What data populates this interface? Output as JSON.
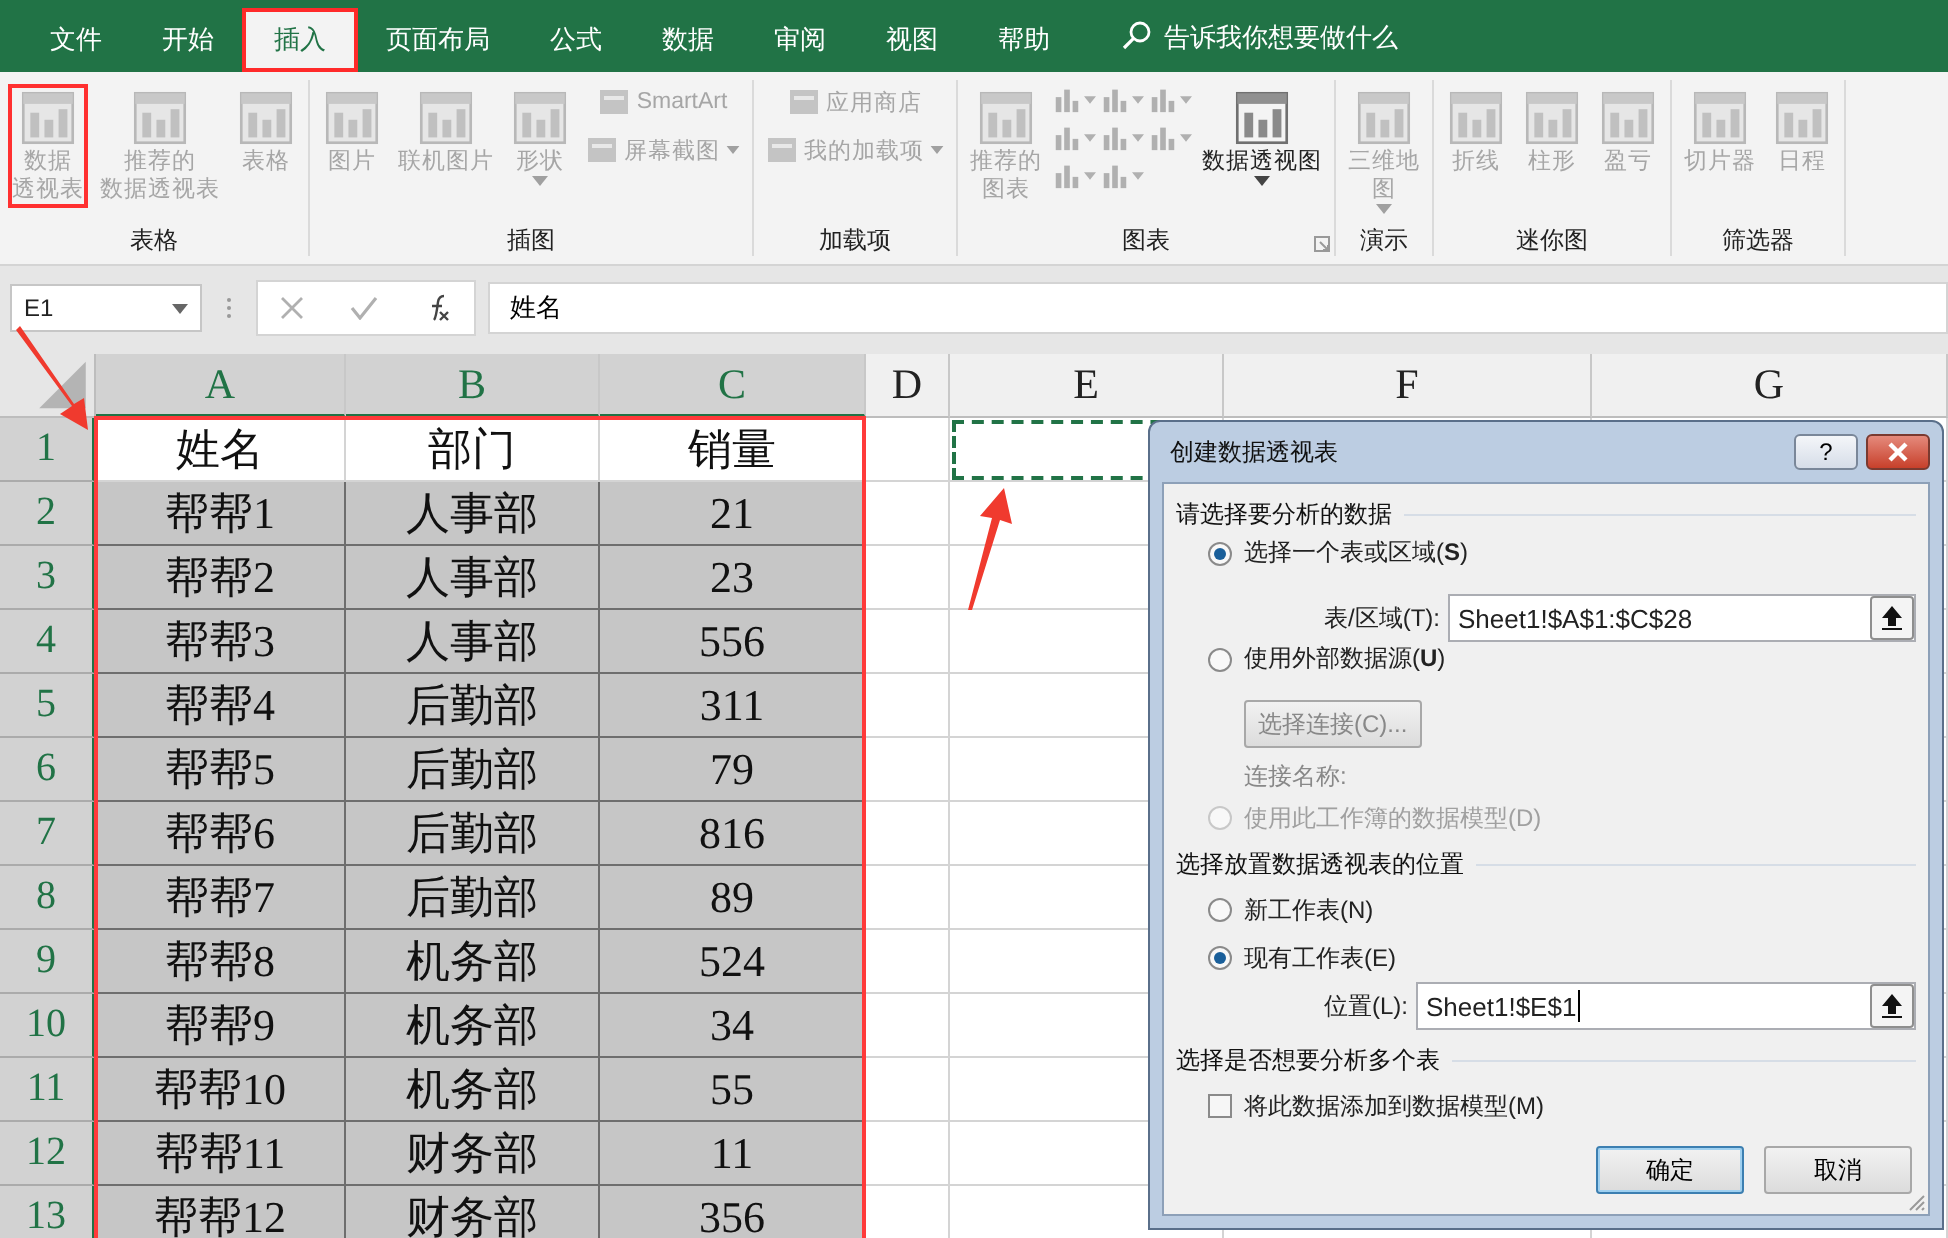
{
  "ribbon_tabs": [
    {
      "label": "文件",
      "selected": false,
      "highlighted": false
    },
    {
      "label": "开始",
      "selected": false,
      "highlighted": false
    },
    {
      "label": "插入",
      "selected": true,
      "highlighted": true
    },
    {
      "label": "页面布局",
      "selected": false,
      "highlighted": false
    },
    {
      "label": "公式",
      "selected": false,
      "highlighted": false
    },
    {
      "label": "数据",
      "selected": false,
      "highlighted": false
    },
    {
      "label": "审阅",
      "selected": false,
      "highlighted": false
    },
    {
      "label": "视图",
      "selected": false,
      "highlighted": false
    },
    {
      "label": "帮助",
      "selected": false,
      "highlighted": false
    }
  ],
  "tell_me": {
    "placeholder": "告诉我你想要做什么"
  },
  "ribbon_groups": [
    {
      "label": "表格",
      "columns": [
        [
          {
            "kind": "large",
            "lines": [
              "数据",
              "透视表"
            ],
            "disabled": true,
            "highlighted": true
          }
        ],
        [
          {
            "kind": "large",
            "lines": [
              "推荐的",
              "数据透视表"
            ],
            "disabled": true
          }
        ],
        [
          {
            "kind": "large",
            "lines": [
              "表格"
            ],
            "disabled": true
          }
        ]
      ]
    },
    {
      "label": "插图",
      "columns": [
        [
          {
            "kind": "large",
            "lines": [
              "图片"
            ],
            "disabled": true
          }
        ],
        [
          {
            "kind": "large",
            "lines": [
              "联机图片"
            ],
            "disabled": true
          }
        ],
        [
          {
            "kind": "large",
            "lines": [
              "形状"
            ],
            "disabled": true,
            "dropdown": true
          }
        ],
        [
          {
            "kind": "small",
            "lines": [
              "SmartArt"
            ],
            "disabled": true
          },
          {
            "kind": "small",
            "lines": [
              "屏幕截图"
            ],
            "disabled": true,
            "dropdown": true
          }
        ]
      ]
    },
    {
      "label": "加载项",
      "columns": [
        [
          {
            "kind": "small",
            "lines": [
              "应用商店"
            ],
            "disabled": true
          },
          {
            "kind": "small",
            "lines": [
              "我的加载项"
            ],
            "disabled": true,
            "dropdown": true
          }
        ]
      ]
    },
    {
      "label": "图表",
      "launcher": true,
      "columns": [
        [
          {
            "kind": "large",
            "lines": [
              "推荐的",
              "图表"
            ],
            "disabled": true
          }
        ],
        [
          {
            "kind": "chart-menu",
            "disabled": true
          },
          {
            "kind": "chart-menu",
            "disabled": true
          },
          {
            "kind": "chart-menu",
            "disabled": true
          }
        ],
        [
          {
            "kind": "chart-menu",
            "disabled": true
          },
          {
            "kind": "chart-menu",
            "disabled": true
          },
          {
            "kind": "chart-menu",
            "disabled": true
          }
        ],
        [
          {
            "kind": "chart-menu",
            "disabled": true
          },
          {
            "kind": "chart-menu",
            "disabled": true
          }
        ],
        [
          {
            "kind": "large",
            "lines": [
              "数据透视图"
            ],
            "disabled": false,
            "dropdown": true
          }
        ]
      ]
    },
    {
      "label": "演示",
      "columns": [
        [
          {
            "kind": "large",
            "lines": [
              "三维地",
              "图"
            ],
            "disabled": true,
            "dropdown": true
          }
        ]
      ]
    },
    {
      "label": "迷你图",
      "columns": [
        [
          {
            "kind": "large",
            "lines": [
              "折线"
            ],
            "disabled": true
          }
        ],
        [
          {
            "kind": "large",
            "lines": [
              "柱形"
            ],
            "disabled": true
          }
        ],
        [
          {
            "kind": "large",
            "lines": [
              "盈亏"
            ],
            "disabled": true
          }
        ]
      ]
    },
    {
      "label": "筛选器",
      "columns": [
        [
          {
            "kind": "large",
            "lines": [
              "切片器"
            ],
            "disabled": true
          }
        ],
        [
          {
            "kind": "large",
            "lines": [
              "日程"
            ],
            "disabled": true
          }
        ]
      ]
    }
  ],
  "formula_bar": {
    "name_box": "E1",
    "value": "姓名"
  },
  "sheet": {
    "columns": [
      {
        "label": "A",
        "selected": true
      },
      {
        "label": "B",
        "selected": true
      },
      {
        "label": "C",
        "selected": true
      },
      {
        "label": "D",
        "selected": false
      },
      {
        "label": "E",
        "selected": false
      },
      {
        "label": "F",
        "selected": false
      },
      {
        "label": "G",
        "selected": false
      }
    ],
    "rows": [
      {
        "number": "1",
        "shaded": false,
        "marquee_e": true,
        "cells": [
          "姓名",
          "部门",
          "销量"
        ]
      },
      {
        "number": "2",
        "shaded": true,
        "marquee_e": false,
        "cells": [
          "帮帮1",
          "人事部",
          "21"
        ]
      },
      {
        "number": "3",
        "shaded": true,
        "marquee_e": false,
        "cells": [
          "帮帮2",
          "人事部",
          "23"
        ]
      },
      {
        "number": "4",
        "shaded": true,
        "marquee_e": false,
        "cells": [
          "帮帮3",
          "人事部",
          "556"
        ]
      },
      {
        "number": "5",
        "shaded": true,
        "marquee_e": false,
        "cells": [
          "帮帮4",
          "后勤部",
          "311"
        ]
      },
      {
        "number": "6",
        "shaded": true,
        "marquee_e": false,
        "cells": [
          "帮帮5",
          "后勤部",
          "79"
        ]
      },
      {
        "number": "7",
        "shaded": true,
        "marquee_e": false,
        "cells": [
          "帮帮6",
          "后勤部",
          "816"
        ]
      },
      {
        "number": "8",
        "shaded": true,
        "marquee_e": false,
        "cells": [
          "帮帮7",
          "后勤部",
          "89"
        ]
      },
      {
        "number": "9",
        "shaded": true,
        "marquee_e": false,
        "cells": [
          "帮帮8",
          "机务部",
          "524"
        ]
      },
      {
        "number": "10",
        "shaded": true,
        "marquee_e": false,
        "cells": [
          "帮帮9",
          "机务部",
          "34"
        ]
      },
      {
        "number": "11",
        "shaded": true,
        "marquee_e": false,
        "cells": [
          "帮帮10",
          "机务部",
          "55"
        ]
      },
      {
        "number": "12",
        "shaded": true,
        "marquee_e": false,
        "cells": [
          "帮帮11",
          "财务部",
          "11"
        ]
      },
      {
        "number": "13",
        "shaded": true,
        "marquee_e": false,
        "cells": [
          "帮帮12",
          "财务部",
          "356"
        ]
      }
    ]
  },
  "dialog": {
    "title": "创建数据透视表",
    "help": "?",
    "section_1": "请选择要分析的数据",
    "source_options": [
      {
        "label": "选择一个表或区域(**S**)",
        "selected": true,
        "disabled": false
      },
      {
        "label": "使用外部数据源(**U**)",
        "selected": false,
        "disabled": false
      },
      {
        "label": "使用此工作簿的数据模型(D)",
        "selected": false,
        "disabled": true
      }
    ],
    "range_label": "表/区域(T):",
    "range_value": "Sheet1!$A$1:$C$28",
    "connect_button": "选择连接(C)...",
    "connection_name_label": "连接名称:",
    "section_2": "选择放置数据透视表的位置",
    "location_options": [
      {
        "label": "新工作表(N)",
        "selected": false,
        "disabled": false
      },
      {
        "label": "现有工作表(E)",
        "selected": true,
        "disabled": false
      }
    ],
    "location_label": "位置(L):",
    "location_value": "Sheet1!$E$1",
    "section_3": "选择是否想要分析多个表",
    "data_model_checkbox": {
      "label": "将此数据添加到数据模型(M)",
      "checked": false
    },
    "ok": "确定",
    "cancel": "取消"
  }
}
